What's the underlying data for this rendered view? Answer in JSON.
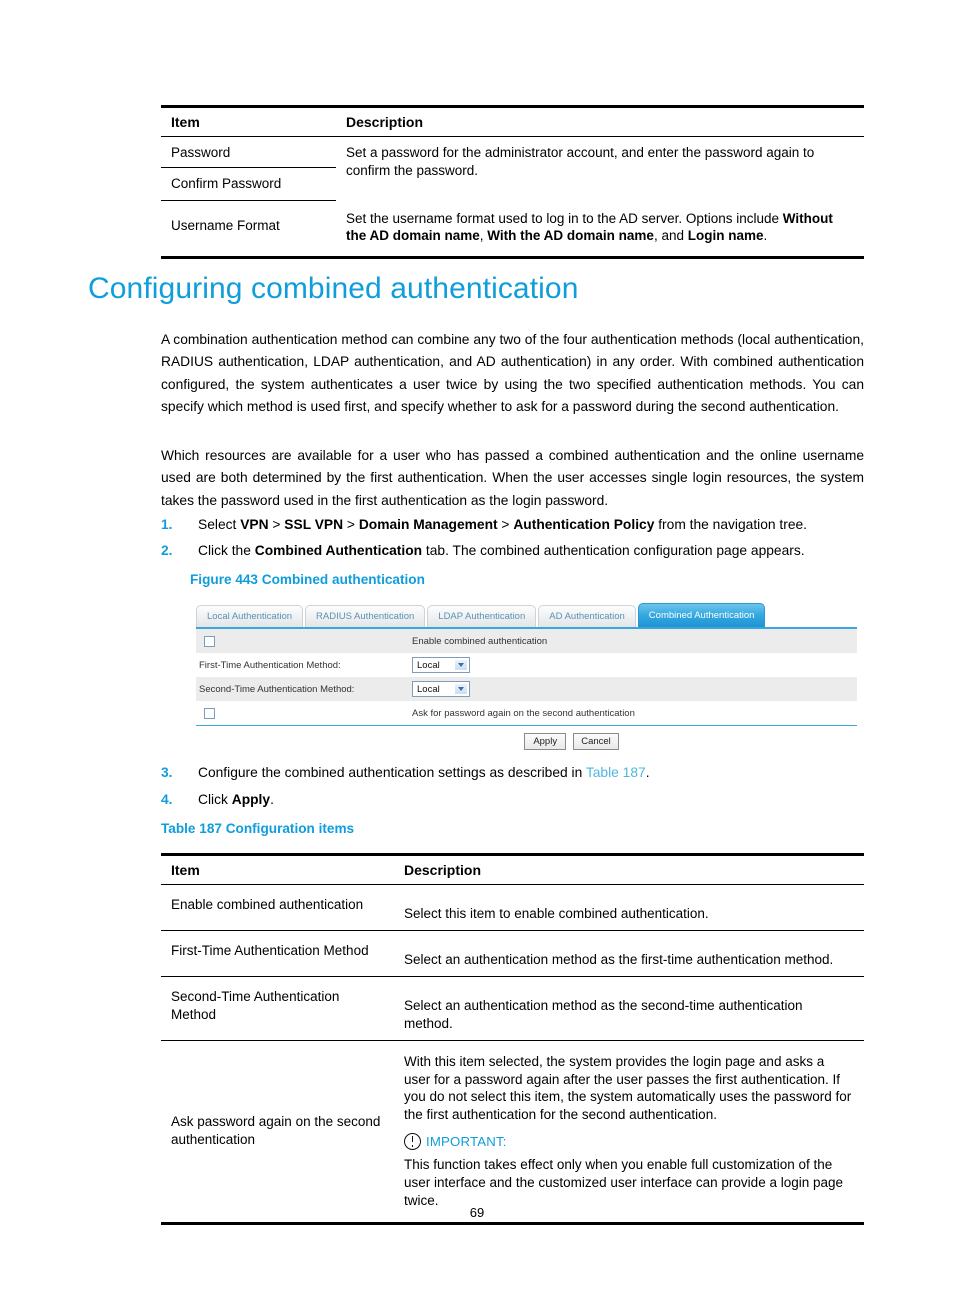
{
  "colors": {
    "accent": "#0f9ddb",
    "link": "#4fb7e0",
    "tab_selected_bg": "#1d94d4",
    "tab_inactive_text": "#5b92b5",
    "row_shade": "#ececec"
  },
  "top_table": {
    "headers": {
      "item": "Item",
      "description": "Description"
    },
    "rows": [
      {
        "items": [
          "Password",
          "Confirm Password"
        ],
        "description_plain": "Set a password for the administrator account, and enter the password again to confirm the password."
      },
      {
        "items": [
          "Username Format"
        ],
        "description_parts": [
          {
            "text": "Set the username format used to log in to the AD server. Options include ",
            "bold": false
          },
          {
            "text": "Without the AD domain name",
            "bold": true
          },
          {
            "text": ", ",
            "bold": false
          },
          {
            "text": "With the AD domain name",
            "bold": true
          },
          {
            "text": ", and ",
            "bold": false
          },
          {
            "text": "Login name",
            "bold": true
          },
          {
            "text": ".",
            "bold": false
          }
        ]
      }
    ]
  },
  "section": {
    "heading": "Configuring combined authentication",
    "paragraph_1": "A combination authentication method can combine any two of the four authentication methods (local authentication, RADIUS authentication, LDAP authentication, and AD authentication) in any order. With combined authentication configured, the system authenticates a user twice by using the two specified authentication methods. You can specify which method is used first, and specify whether to ask for a password during the second authentication.",
    "paragraph_2": "Which resources are available for a user who has passed a combined authentication and the online username used are both determined by the first authentication. When the user accesses single login resources, the system takes the password used in the first authentication as the login password."
  },
  "steps": [
    {
      "num": "1.",
      "parts": [
        {
          "text": "Select ",
          "style": "normal"
        },
        {
          "text": "VPN",
          "style": "bold"
        },
        {
          "text": " > ",
          "style": "normal"
        },
        {
          "text": "SSL VPN",
          "style": "bold"
        },
        {
          "text": " > ",
          "style": "normal"
        },
        {
          "text": "Domain Management",
          "style": "bold"
        },
        {
          "text": " > ",
          "style": "normal"
        },
        {
          "text": "Authentication Policy",
          "style": "bold"
        },
        {
          "text": " from the navigation tree.",
          "style": "normal"
        }
      ]
    },
    {
      "num": "2.",
      "parts": [
        {
          "text": "Click the ",
          "style": "normal"
        },
        {
          "text": "Combined Authentication",
          "style": "bold"
        },
        {
          "text": " tab. The combined authentication configuration page appears.",
          "style": "normal"
        }
      ]
    },
    {
      "num": "3.",
      "parts": [
        {
          "text": "Configure the combined authentication settings as described in ",
          "style": "normal"
        },
        {
          "text": "Table 187",
          "style": "link"
        },
        {
          "text": ".",
          "style": "normal"
        }
      ]
    },
    {
      "num": "4.",
      "parts": [
        {
          "text": "Click ",
          "style": "normal"
        },
        {
          "text": "Apply",
          "style": "bold"
        },
        {
          "text": ".",
          "style": "normal"
        }
      ]
    }
  ],
  "figure": {
    "caption": "Figure 443 Combined authentication",
    "tabs": [
      {
        "label": "Local Authentication",
        "selected": false
      },
      {
        "label": "RADIUS Authentication",
        "selected": false
      },
      {
        "label": "LDAP Authentication",
        "selected": false
      },
      {
        "label": "AD Authentication",
        "selected": false
      },
      {
        "label": "Combined Authentication",
        "selected": true
      }
    ],
    "enable_checkbox_label": "Enable combined authentication",
    "enable_checkbox_checked": false,
    "first_method_label": "First-Time Authentication Method:",
    "first_method_value": "Local",
    "second_method_label": "Second-Time Authentication Method:",
    "second_method_value": "Local",
    "ask_password_label": "Ask for password again on the second authentication",
    "ask_password_checked": false,
    "apply_label": "Apply",
    "cancel_label": "Cancel"
  },
  "bottom_table": {
    "caption": "Table 187 Configuration items",
    "headers": {
      "item": "Item",
      "description": "Description"
    },
    "rows": [
      {
        "item": "Enable combined authentication",
        "description": "Select this item to enable combined authentication."
      },
      {
        "item": "First-Time Authentication Method",
        "description": "Select an authentication method as the first-time authentication method."
      },
      {
        "item": "Second-Time Authentication Method",
        "description": "Select an authentication method as the second-time authentication method."
      },
      {
        "item": "Ask password again on the second authentication",
        "description": "With this item selected, the system provides the login page and asks a user for a password again after the user passes the first authentication. If you do not select this item, the system automatically uses the password for the first authentication for the second authentication.",
        "important_label": "IMPORTANT:",
        "important_text": "This function takes effect only when you enable full customization of the user interface and the customized user interface can provide a login page twice."
      }
    ]
  },
  "footer": {
    "page_number": "69"
  }
}
